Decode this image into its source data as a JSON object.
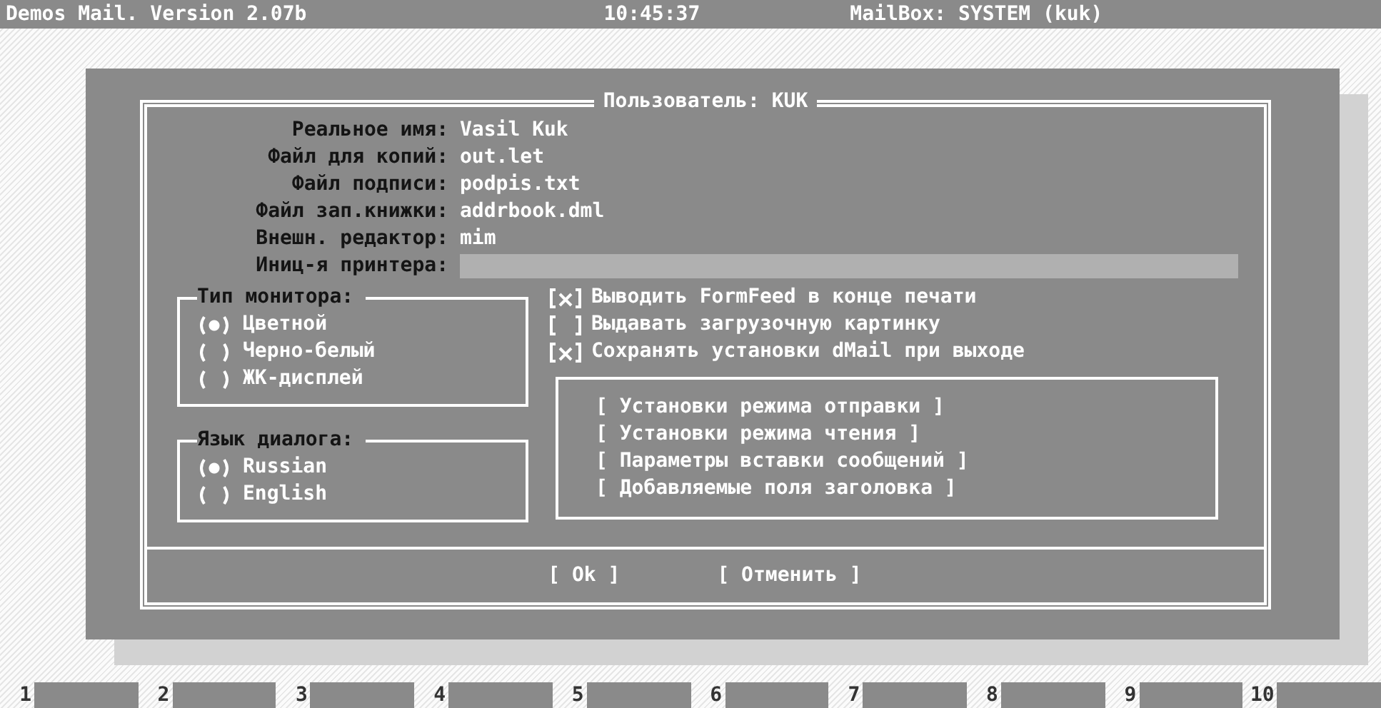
{
  "top_bar": {
    "app_title": "Demos Mail. Version 2.07b",
    "time": "10:45:37",
    "mailbox": "MailBox: SYSTEM (kuk)"
  },
  "dialog": {
    "title": "Пользователь: KUK",
    "fields": [
      {
        "label": "Реальное имя:",
        "value": "Vasil Kuk"
      },
      {
        "label": "Файл для копий:",
        "value": "out.let"
      },
      {
        "label": "Файл подписи:",
        "value": "podpis.txt"
      },
      {
        "label": "Файл зап.книжки:",
        "value": "addrbook.dml"
      },
      {
        "label": "Внешн. редактор:",
        "value": "mim"
      },
      {
        "label": "Иниц-я принтера:"
      }
    ],
    "radio_groups": [
      {
        "title": "Тип монитора:",
        "options": [
          {
            "label": "Цветной",
            "selected": true
          },
          {
            "label": "Черно-белый",
            "selected": false
          },
          {
            "label": "ЖК-дисплей",
            "selected": false
          }
        ]
      },
      {
        "title": "Язык диалога:",
        "options": [
          {
            "label": "Russian",
            "selected": true
          },
          {
            "label": "English",
            "selected": false
          }
        ]
      }
    ],
    "checkboxes": [
      {
        "label": "Выводить FormFeed в конце печати",
        "checked": true
      },
      {
        "label": "Выдавать загрузочную картинку",
        "checked": false
      },
      {
        "label": "Сохранять установки dMail при выходе",
        "checked": true
      }
    ],
    "settings_buttons": [
      "[ Установки режима отправки ]",
      "[ Установки режима чтения ]",
      "[ Параметры вставки сообщений ]",
      "[ Добавляемые поля заголовка ]"
    ],
    "buttons": [
      "[ Ok ]",
      "[ Отменить ]"
    ]
  },
  "function_keys": [
    "1",
    "2",
    "3",
    "4",
    "5",
    "6",
    "7",
    "8",
    "9",
    "10"
  ]
}
